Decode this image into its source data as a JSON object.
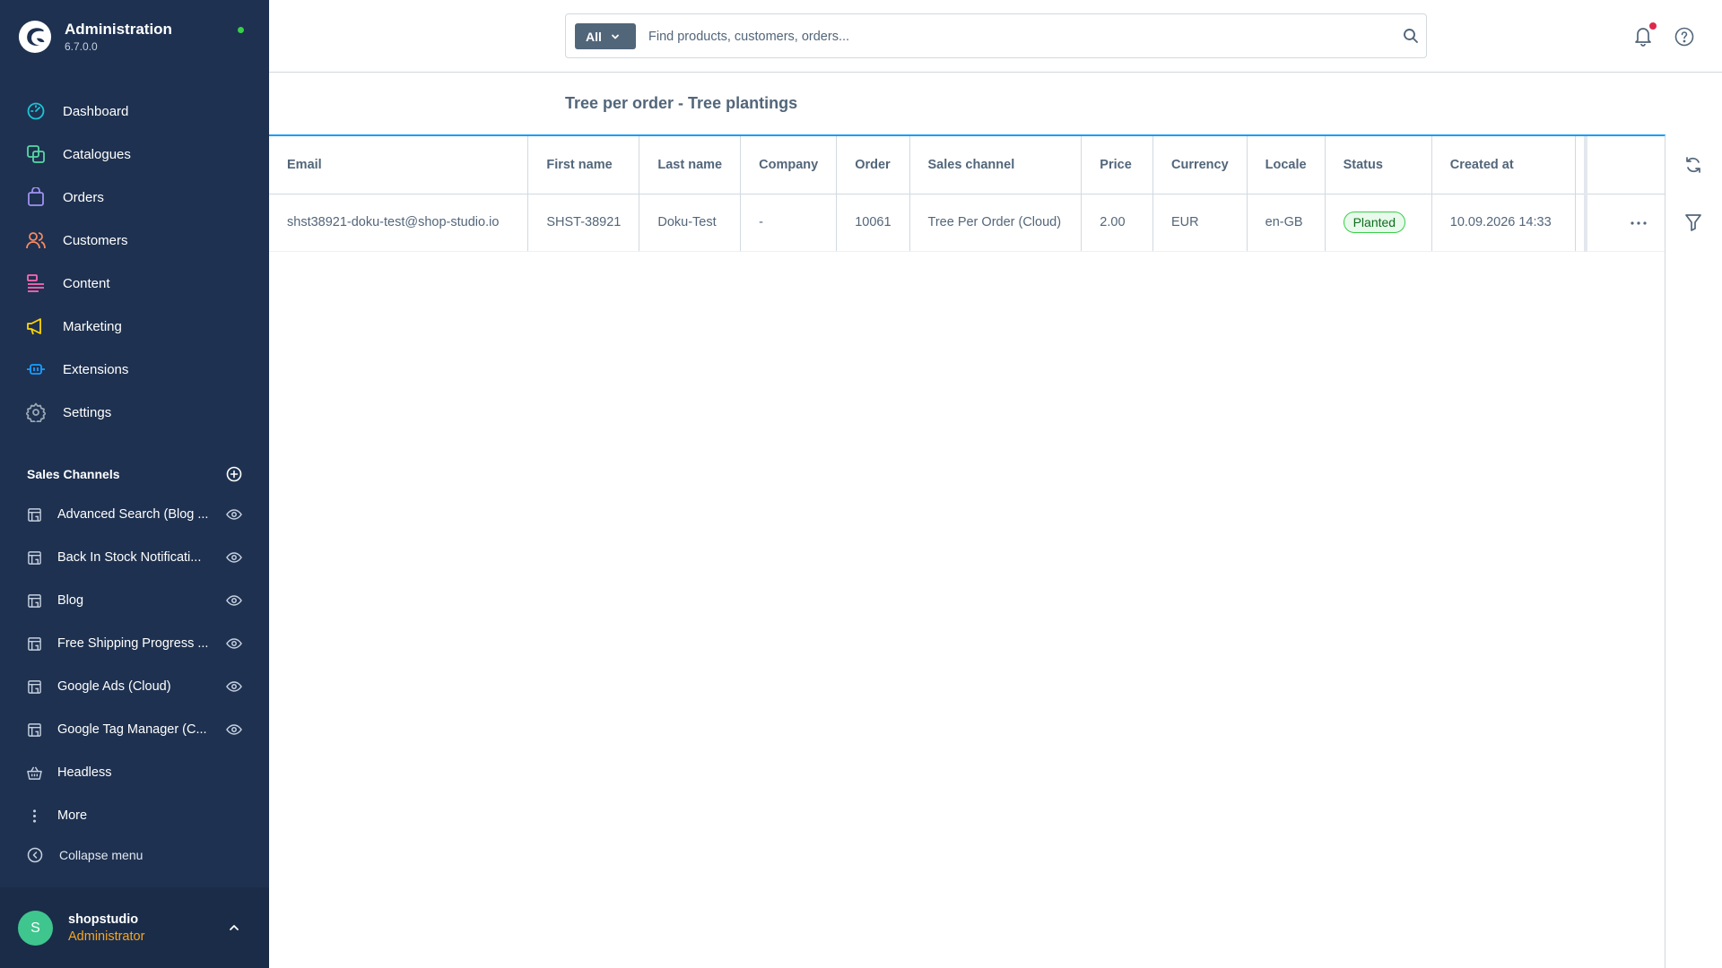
{
  "app": {
    "title": "Administration",
    "version": "6.7.0.0"
  },
  "nav": [
    {
      "label": "Dashboard",
      "icon": "dashboard-icon"
    },
    {
      "label": "Catalogues",
      "icon": "catalogues-icon"
    },
    {
      "label": "Orders",
      "icon": "orders-icon"
    },
    {
      "label": "Customers",
      "icon": "customers-icon"
    },
    {
      "label": "Content",
      "icon": "content-icon"
    },
    {
      "label": "Marketing",
      "icon": "marketing-icon"
    },
    {
      "label": "Extensions",
      "icon": "extensions-icon"
    },
    {
      "label": "Settings",
      "icon": "settings-icon"
    }
  ],
  "sales_channels": {
    "title": "Sales Channels",
    "items": [
      {
        "label": "Advanced Search (Blog ...",
        "icon": "storefront-icon"
      },
      {
        "label": "Back In Stock Notificati...",
        "icon": "storefront-icon"
      },
      {
        "label": "Blog",
        "icon": "storefront-icon"
      },
      {
        "label": "Free Shipping Progress ...",
        "icon": "storefront-icon"
      },
      {
        "label": "Google Ads (Cloud)",
        "icon": "storefront-icon"
      },
      {
        "label": "Google Tag Manager (C...",
        "icon": "storefront-icon"
      },
      {
        "label": "Headless",
        "icon": "basket-icon"
      }
    ],
    "more_label": "More"
  },
  "collapse_label": "Collapse menu",
  "user": {
    "initial": "S",
    "name": "shopstudio",
    "role": "Administrator"
  },
  "search": {
    "type_label": "All",
    "placeholder": "Find products, customers, orders..."
  },
  "page": {
    "title": "Tree per order - Tree plantings"
  },
  "table": {
    "columns": [
      "Email",
      "First name",
      "Last name",
      "Company",
      "Order",
      "Sales channel",
      "Price",
      "Currency",
      "Locale",
      "Status",
      "Created at"
    ],
    "rows": [
      {
        "email": "shst38921-doku-test@shop-studio.io",
        "first_name": "SHST-38921",
        "last_name": "Doku-Test",
        "company": "-",
        "order": "10061",
        "sales_channel": "Tree Per Order (Cloud)",
        "price": "2.00",
        "currency": "EUR",
        "locale": "en-GB",
        "status": "Planted",
        "created_at": "10.09.2026 14:33"
      }
    ]
  },
  "colors": {
    "sidebar_bg": "#1e3150",
    "accent": "#189eff",
    "status_success": "#37d046",
    "role_color": "#f5a623"
  }
}
